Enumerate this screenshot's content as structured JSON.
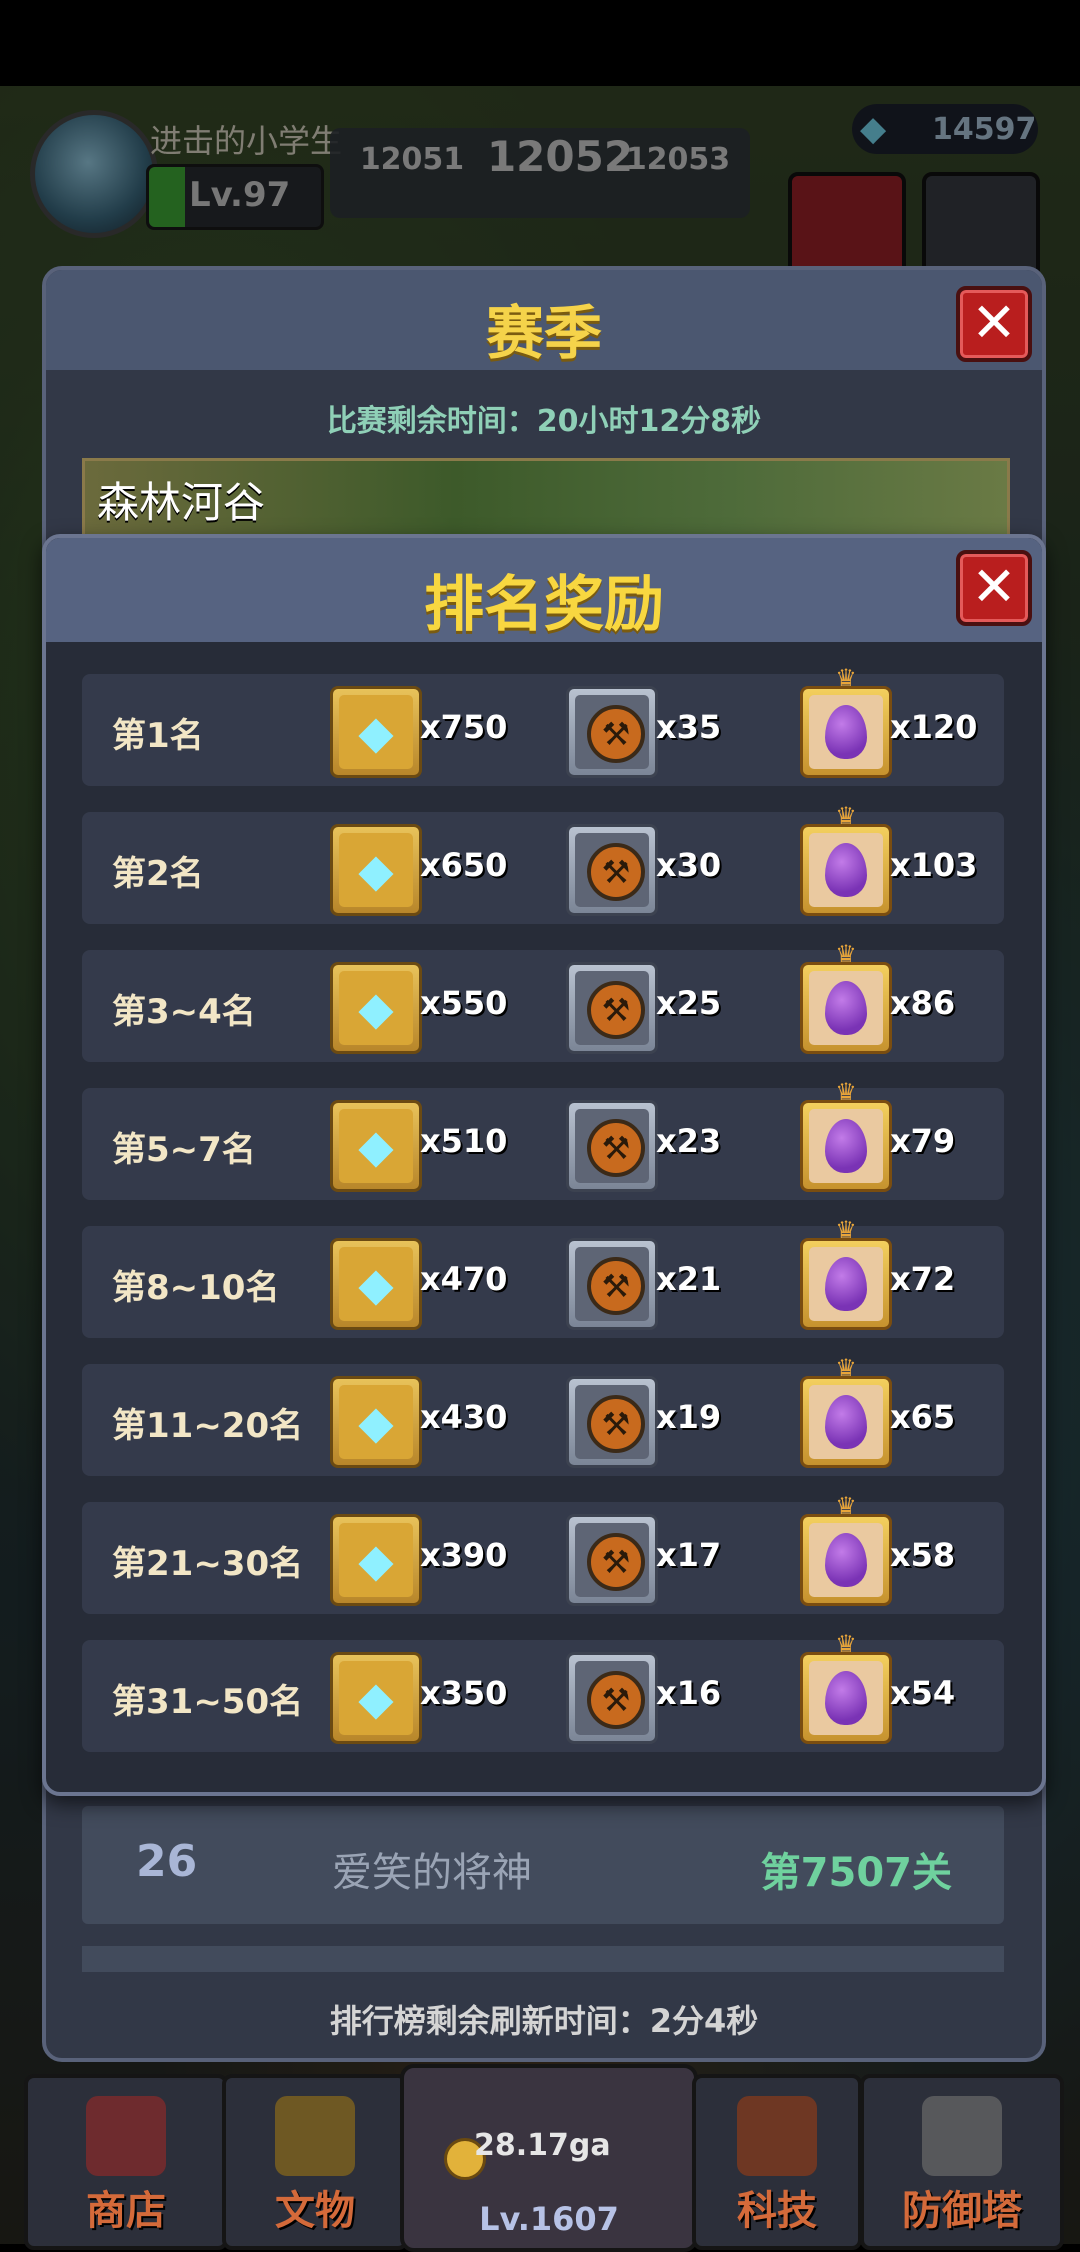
{
  "hud": {
    "player_name": "进击的小学生",
    "level": "Lv.97",
    "stage_prev": "12051",
    "stage_current": "12052",
    "stage_next": "12053",
    "gems": "14597"
  },
  "season": {
    "title": "赛季",
    "close_label": "✕",
    "timer": "比赛剩余时间：20小时12分8秒",
    "map_name": "森林河谷",
    "leaderboard_row": {
      "rank": "26",
      "name": "爱笑的将神",
      "stage": "第7507关"
    },
    "refresh": "排行榜剩余刷新时间：2分4秒"
  },
  "rewards": {
    "title": "排名奖励",
    "close_label": "✕",
    "rows": [
      {
        "rank": "第1名",
        "gems": "x750",
        "tools": "x35",
        "eggs": "x120"
      },
      {
        "rank": "第2名",
        "gems": "x650",
        "tools": "x30",
        "eggs": "x103"
      },
      {
        "rank": "第3~4名",
        "gems": "x550",
        "tools": "x25",
        "eggs": "x86"
      },
      {
        "rank": "第5~7名",
        "gems": "x510",
        "tools": "x23",
        "eggs": "x79"
      },
      {
        "rank": "第8~10名",
        "gems": "x470",
        "tools": "x21",
        "eggs": "x72"
      },
      {
        "rank": "第11~20名",
        "gems": "x430",
        "tools": "x19",
        "eggs": "x65"
      },
      {
        "rank": "第21~30名",
        "gems": "x390",
        "tools": "x17",
        "eggs": "x58"
      },
      {
        "rank": "第31~50名",
        "gems": "x350",
        "tools": "x16",
        "eggs": "x54"
      }
    ]
  },
  "nav": {
    "shop": "商店",
    "relics": "文物",
    "gold": "28.17ga",
    "hero_level": "Lv.1607",
    "tech": "科技",
    "tower": "防御塔"
  },
  "colors": {
    "title_gold": "#f8d740",
    "close_red": "#b91e1e",
    "timer_green": "#8fd0b7",
    "stage_green": "#6fd19e"
  }
}
